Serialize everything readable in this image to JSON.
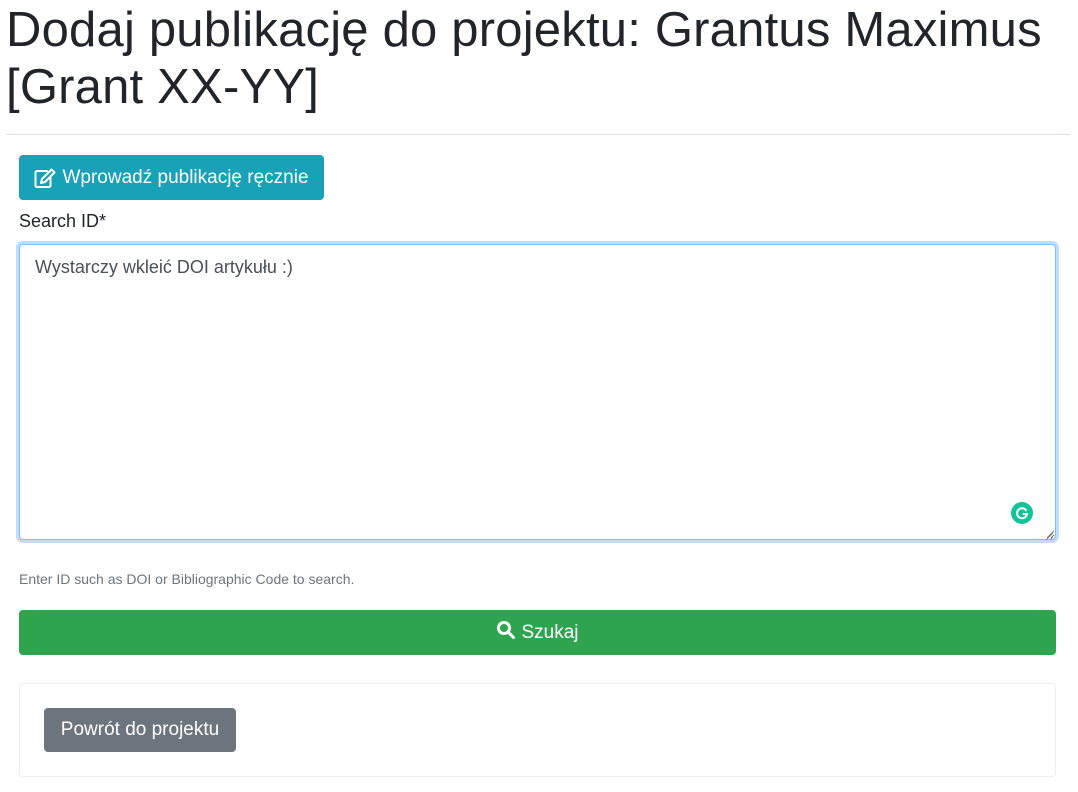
{
  "page": {
    "title": "Dodaj publikację do projektu: Grantus Maximus [Grant XX-YY]"
  },
  "manual_entry": {
    "label": "Wprowadź publikację ręcznie",
    "icon": "edit-icon",
    "color": "#17a2b8"
  },
  "search_field": {
    "label": "Search ID*",
    "placeholder": "Wystarczy wkleić DOI artykułu :)",
    "value": "",
    "help_text": "Enter ID such as DOI or Bibliographic Code to search.",
    "extension_icon": "grammarly-icon"
  },
  "search_button": {
    "label": "Szukaj",
    "icon": "search-icon",
    "color": "#2ea44f"
  },
  "footer": {
    "back_label": "Powrót do projektu",
    "back_color": "#6c757d"
  }
}
